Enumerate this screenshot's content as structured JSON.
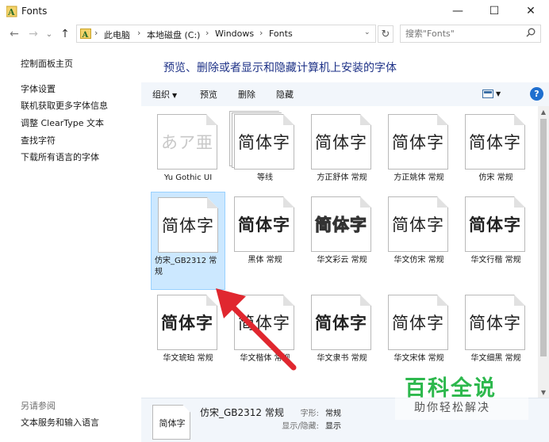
{
  "window": {
    "title": "Fonts",
    "minimize": "—",
    "maximize": "☐",
    "close": "✕"
  },
  "nav": {
    "back": "←",
    "forward": "→",
    "dropdown": "⌄",
    "up": "↑"
  },
  "address": {
    "crumbs": [
      "此电脑",
      "本地磁盘 (C:)",
      "Windows",
      "Fonts"
    ],
    "separator": "›",
    "dropdown": "⌄",
    "refresh": "↻"
  },
  "search": {
    "placeholder": "搜索\"Fonts\""
  },
  "sidebar": {
    "links": [
      "控制面板主页",
      "字体设置",
      "联机获取更多字体信息",
      "调整 ClearType 文本",
      "查找字符",
      "下载所有语言的字体"
    ],
    "see_also_title": "另请参阅",
    "see_also_links": [
      "文本服务和输入语言"
    ]
  },
  "heading": "预览、删除或者显示和隐藏计算机上安装的字体",
  "toolbar": {
    "organize": "组织",
    "preview": "预览",
    "delete": "删除",
    "hide": "隐藏",
    "help": "?"
  },
  "fonts": [
    {
      "sample": "あア亜",
      "label": "Yu Gothic UI",
      "style": "light"
    },
    {
      "sample": "简体字",
      "label": "等线",
      "style": "stack"
    },
    {
      "sample": "简体字",
      "label": "方正舒体 常规",
      "style": "script"
    },
    {
      "sample": "简体字",
      "label": "方正姚体 常规",
      "style": "normal"
    },
    {
      "sample": "简体字",
      "label": "仿宋 常规",
      "style": "normal"
    },
    {
      "sample": "简体字",
      "label": "仿宋_GB2312 常规",
      "style": "selected"
    },
    {
      "sample": "简体字",
      "label": "黑体 常规",
      "style": "bold"
    },
    {
      "sample": "简体字",
      "label": "华文彩云 常规",
      "style": "outline"
    },
    {
      "sample": "简体字",
      "label": "华文仿宋 常规",
      "style": "normal"
    },
    {
      "sample": "简体字",
      "label": "华文行楷 常规",
      "style": "bold"
    },
    {
      "sample": "简体字",
      "label": "华文琥珀 常规",
      "style": "bold"
    },
    {
      "sample": "简体字",
      "label": "华文楷体 常规",
      "style": "normal"
    },
    {
      "sample": "简体字",
      "label": "华文隶书 常规",
      "style": "bold"
    },
    {
      "sample": "简体字",
      "label": "华文宋体 常规",
      "style": "normal"
    },
    {
      "sample": "简体字",
      "label": "华文细黑 常规",
      "style": "normal"
    }
  ],
  "scroll": {
    "up": "▲",
    "down": "▼"
  },
  "details": {
    "sample": "简体字",
    "name": "仿宋_GB2312 常规",
    "style_key": "字形:",
    "style_val": "常规",
    "visibility_key": "显示/隐藏:",
    "visibility_val": "显示"
  },
  "watermark": {
    "logo": "百科全说",
    "sub": "助你轻松解决"
  },
  "colors": {
    "accent": "#1e3287",
    "selection": "#cce8ff",
    "arrow": "#e0272f",
    "watermark": "#2db84d"
  }
}
